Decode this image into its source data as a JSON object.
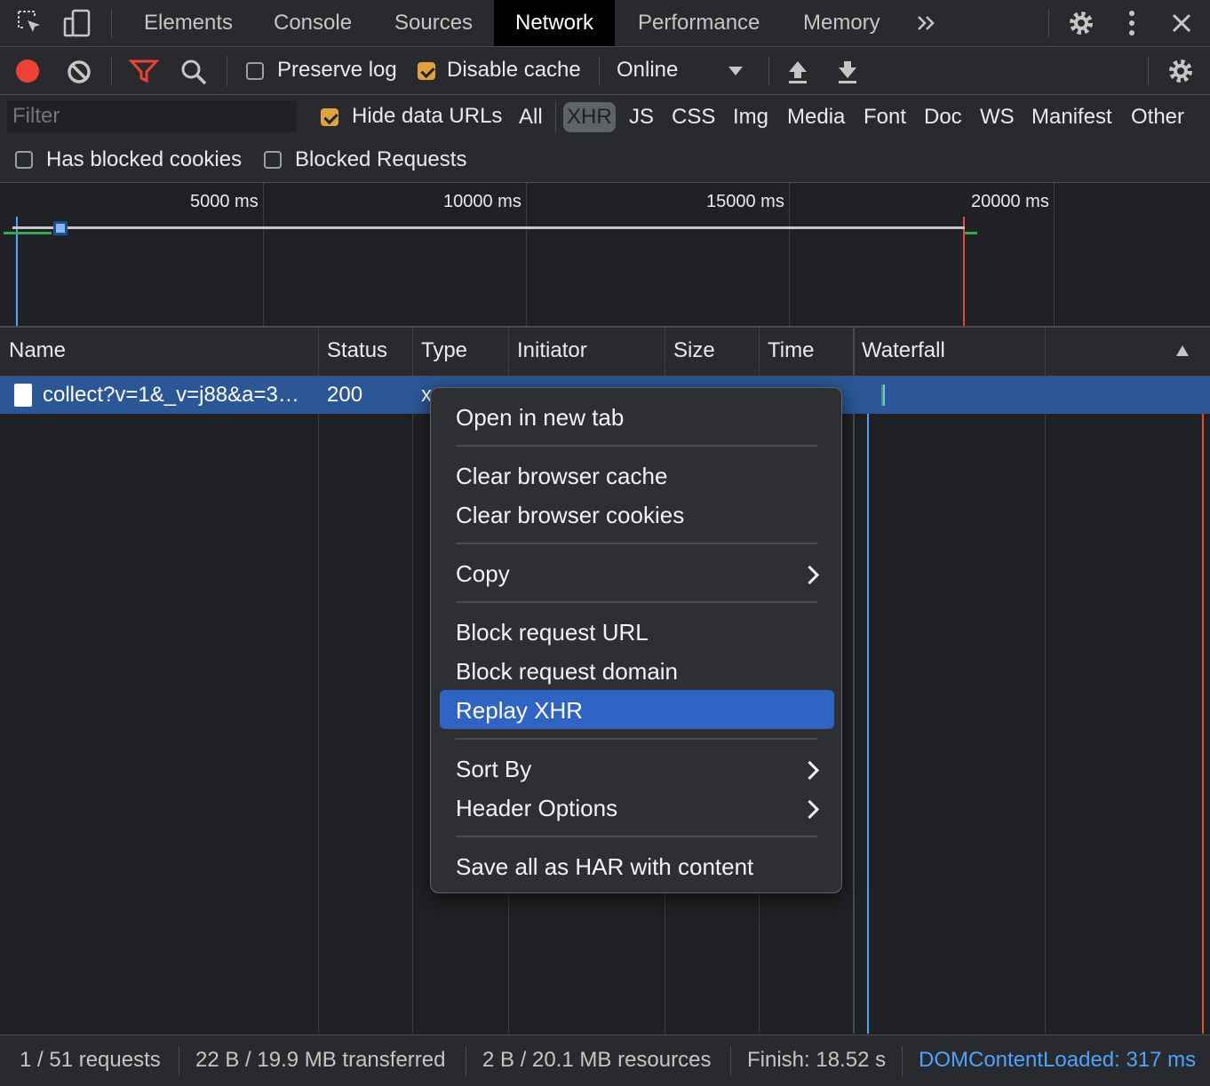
{
  "tabs": {
    "elements": "Elements",
    "console": "Console",
    "sources": "Sources",
    "network": "Network",
    "performance": "Performance",
    "memory": "Memory"
  },
  "toolbar": {
    "preserve_log": "Preserve log",
    "preserve_log_checked": false,
    "disable_cache": "Disable cache",
    "disable_cache_checked": true,
    "throttle": "Online"
  },
  "filter": {
    "placeholder": "Filter",
    "hide_data_urls": "Hide data URLs",
    "types": [
      "All",
      "XHR",
      "JS",
      "CSS",
      "Img",
      "Media",
      "Font",
      "Doc",
      "WS",
      "Manifest",
      "Other"
    ],
    "active_type": "XHR",
    "has_blocked_cookies": "Has blocked cookies",
    "blocked_requests": "Blocked Requests"
  },
  "overview": {
    "ticks": [
      "5000 ms",
      "10000 ms",
      "15000 ms",
      "20000 ms"
    ]
  },
  "table": {
    "columns": [
      "Name",
      "Status",
      "Type",
      "Initiator",
      "Size",
      "Time",
      "Waterfall"
    ],
    "row": {
      "name": "collect?v=1&_v=j88&a=3…",
      "status": "200",
      "type": "x"
    }
  },
  "context_menu": {
    "open_new_tab": "Open in new tab",
    "clear_cache": "Clear browser cache",
    "clear_cookies": "Clear browser cookies",
    "copy": "Copy",
    "block_url": "Block request URL",
    "block_domain": "Block request domain",
    "replay_xhr": "Replay XHR",
    "sort_by": "Sort By",
    "header_options": "Header Options",
    "save_har": "Save all as HAR with content"
  },
  "status": {
    "requests": "1 / 51 requests",
    "transferred": "22 B / 19.9 MB transferred",
    "resources": "2 B / 20.1 MB resources",
    "finish": "Finish: 18.52 s",
    "dom_loaded": "DOMContentLoaded: 317 ms"
  },
  "colors": {
    "accent_blue": "#4da3ff",
    "record_red": "#ef4136",
    "checkbox_orange": "#e0a33c",
    "selection": "#2b5797",
    "menu_highlight": "#2f63c4"
  }
}
